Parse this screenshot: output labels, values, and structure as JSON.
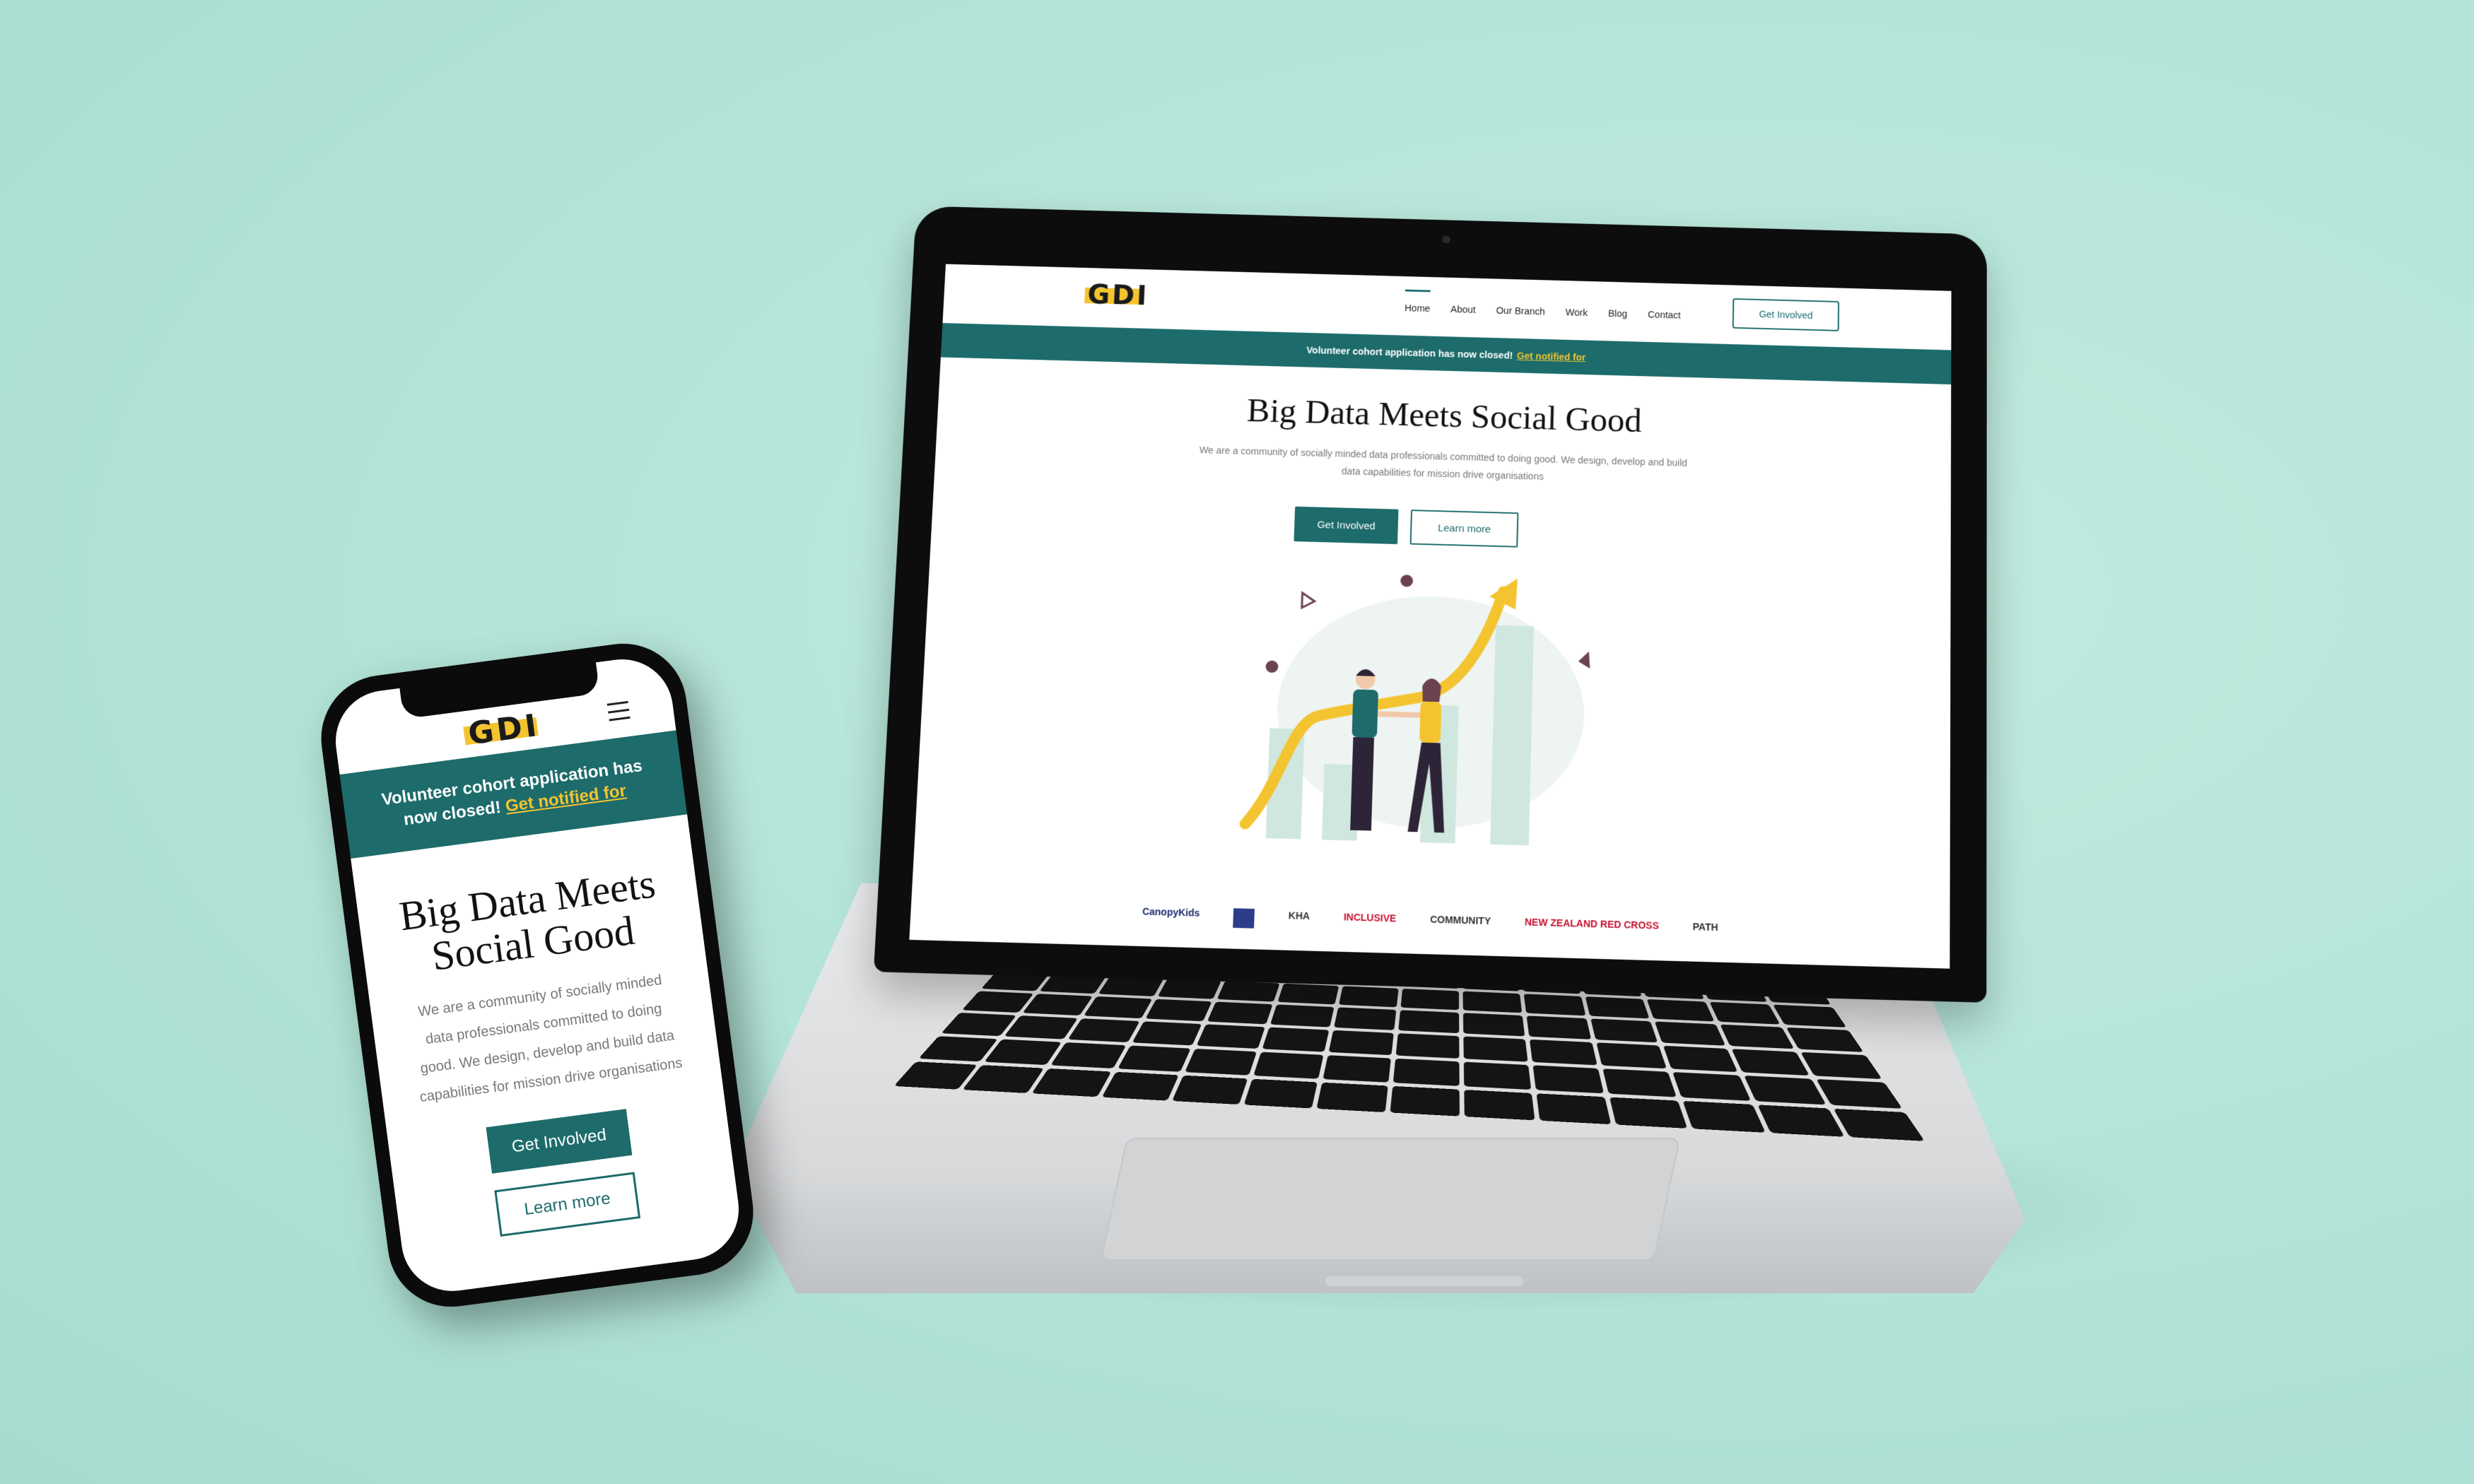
{
  "colors": {
    "background": "#b2e3d7",
    "brand_teal": "#1d6b6b",
    "brand_yellow": "#f4c430"
  },
  "site": {
    "logo": "GDI",
    "nav": [
      "Home",
      "About",
      "Our Branch",
      "Work",
      "Blog",
      "Contact"
    ],
    "active_nav": "Home",
    "header_cta": "Get Involved",
    "banner": {
      "text": "Volunteer cohort application has now closed!",
      "link": "Get notified for"
    },
    "hero": {
      "title": "Big Data Meets Social Good",
      "description": "We are a community of socially minded data professionals committed to doing good. We design, develop and build data capabilities for mission drive organisations",
      "primary_button": "Get Involved",
      "secondary_button": "Learn more"
    },
    "partners": [
      "CanopyKids",
      "KHA",
      "INCLUSIVE",
      "COMMUNITY",
      "NEW ZEALAND RED CROSS",
      "PATH"
    ]
  },
  "mobile": {
    "logo": "GDI",
    "banner_text": "Volunteer cohort application has now closed!",
    "banner_link": "Get notified for",
    "title_line1": "Big Data Meets",
    "title_line2": "Social Good",
    "description": "We are a community of socially minded data professionals committed to doing good. We design, develop and build data capabilities for mission drive organisations",
    "primary_button": "Get Involved",
    "secondary_button": "Learn more"
  }
}
